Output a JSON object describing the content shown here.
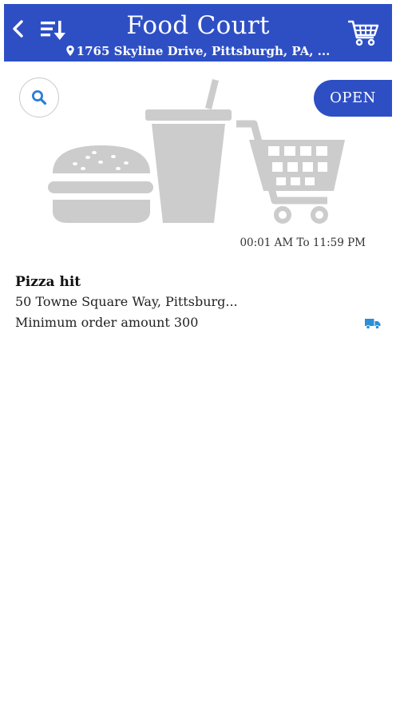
{
  "header": {
    "title": "Food Court",
    "address": "1765 Skyline Drive, Pittsburgh, PA, ...",
    "bar_color": "#2e4fc4",
    "icons": {
      "back": "back-arrow-icon",
      "sort": "sort-icon",
      "location": "map-pin-icon",
      "cart": "shopping-cart-icon"
    }
  },
  "store_status": {
    "label": "OPEN",
    "hours": "00:01 AM To 11:59 PM"
  },
  "banner": {
    "icons": [
      "burger-icon",
      "drink-icon",
      "shopping-cart-icon"
    ],
    "color": "#cccccc"
  },
  "search": {
    "icon": "search-icon",
    "color": "#2a7fd4"
  },
  "restaurant": {
    "name": "Pizza hit",
    "address": "50 Towne Square Way, Pittsburg...",
    "min_order": "Minimum order amount 300",
    "delivery_icon": "delivery-truck-icon",
    "delivery_color": "#2a8fd6"
  }
}
